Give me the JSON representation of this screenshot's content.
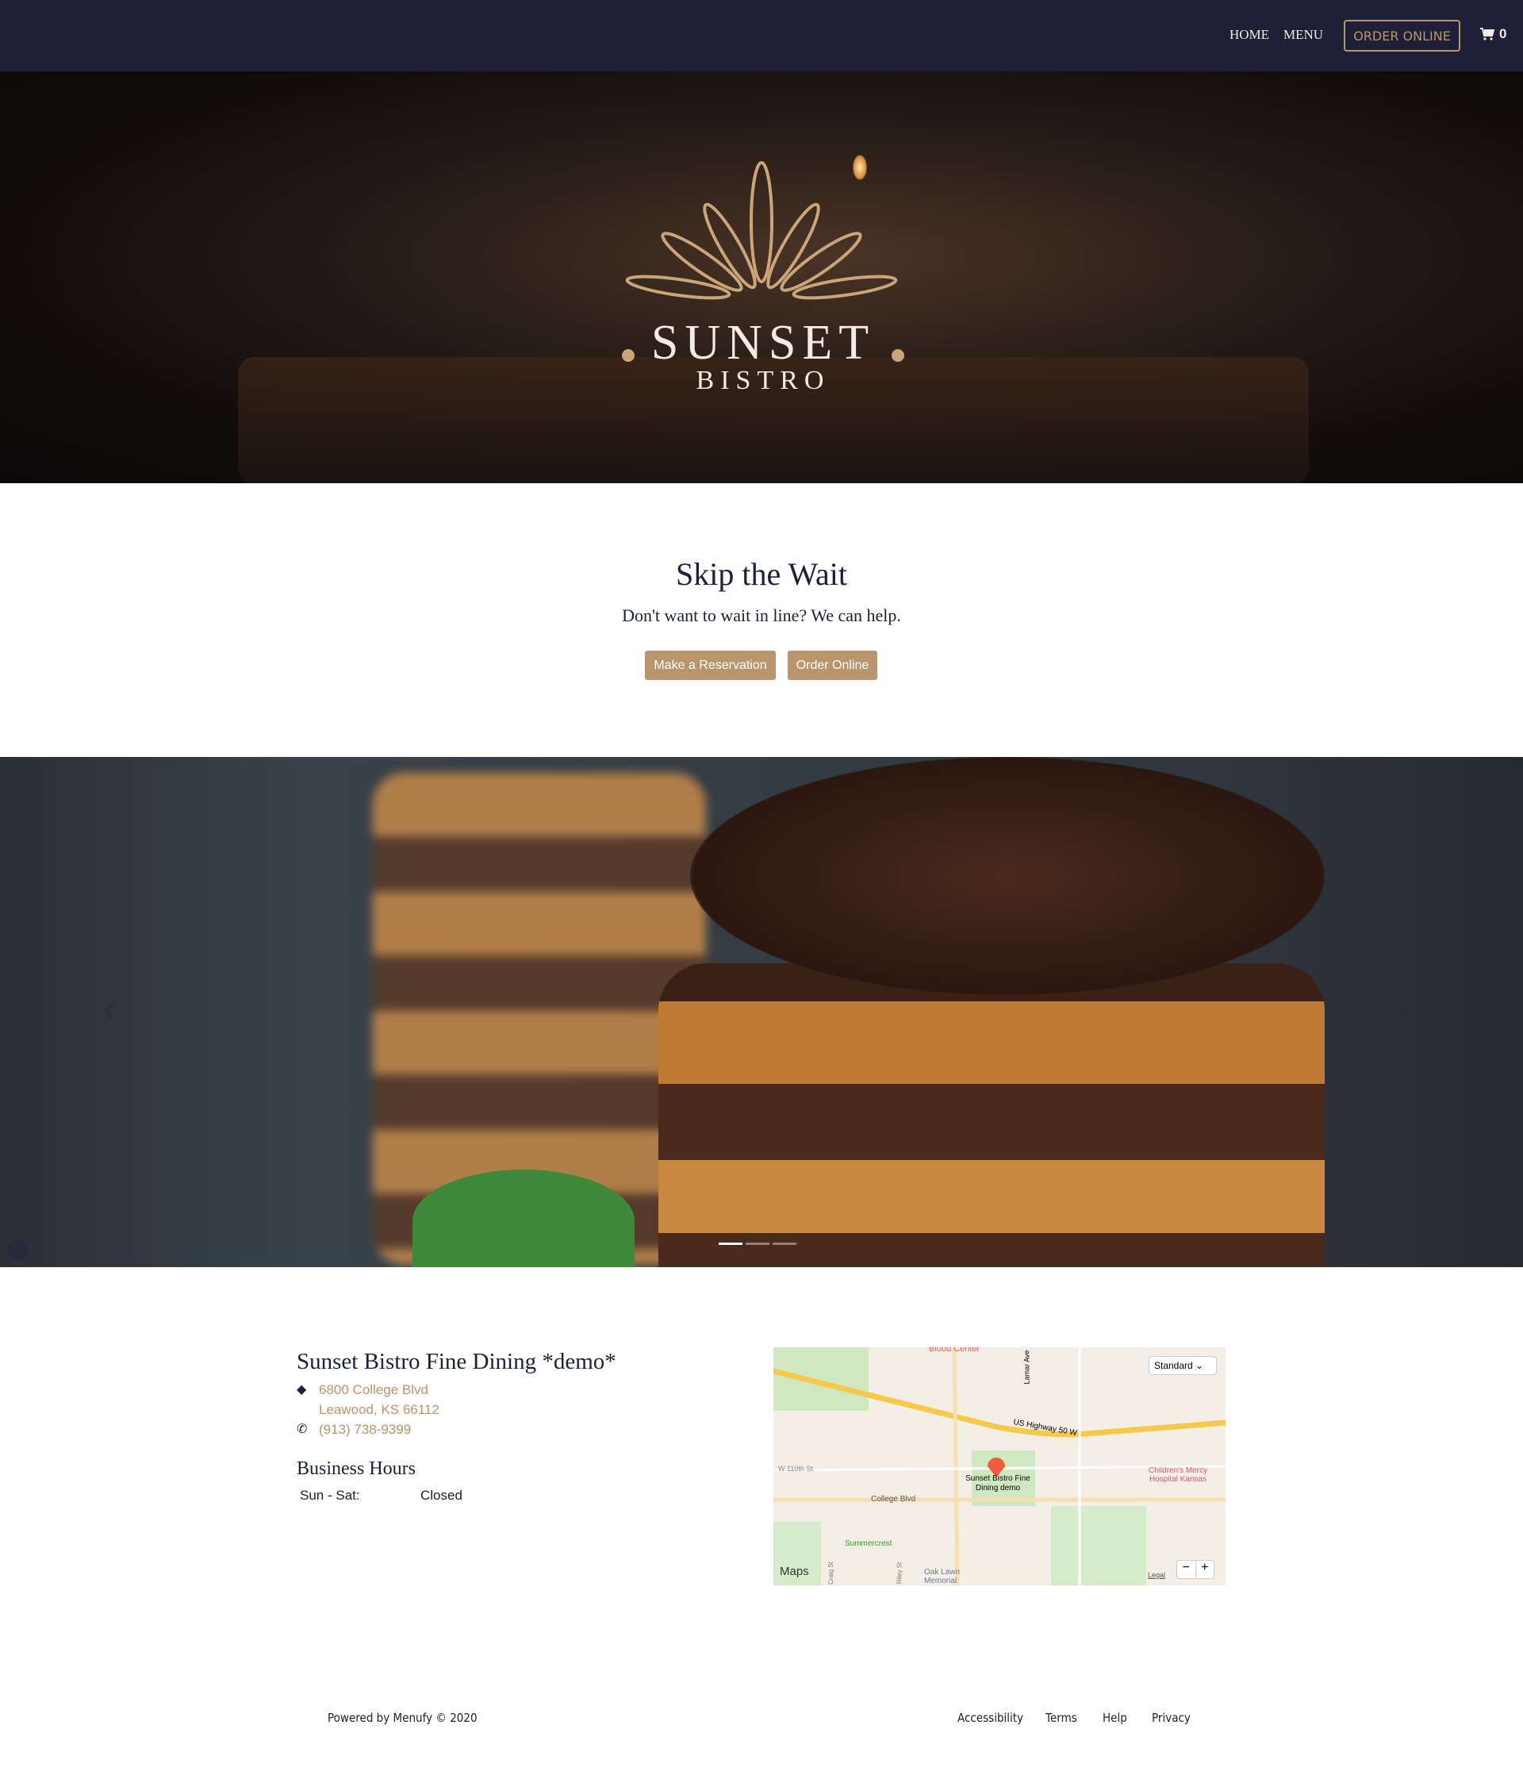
{
  "nav": {
    "home": "HOME",
    "menu": "MENU",
    "order_online": "ORDER ONLINE",
    "cart_count": "0",
    "cart_icon": "shopping-cart-icon"
  },
  "hero": {
    "logo_text": {
      "line1": "SUNSET",
      "line2": "BISTRO"
    }
  },
  "skip": {
    "title": "Skip the Wait",
    "subtitle": "Don't want to wait in line? We can help.",
    "reservation_button": "Make a Reservation",
    "order_button": "Order Online"
  },
  "carousel": {
    "slides": 3,
    "active_slide": 1
  },
  "info": {
    "name": "Sunset Bistro Fine Dining *demo*",
    "address_line1": "6800 College Blvd",
    "address_line2": "Leawood, KS 66112",
    "phone": "(913) 738-9399",
    "hours_title": "Business Hours",
    "hours": [
      {
        "days": "Sun - Sat:",
        "time": "Closed"
      }
    ]
  },
  "map": {
    "type_select": "Standard",
    "pin_label": "Sunset Bistro Fine Dining demo",
    "labels": [
      "Blood Center",
      "Lamar Ave",
      "US Highway 50 W",
      "W 110th St",
      "College Blvd",
      "Children's Mercy Hospital Kansas",
      "Summercrest",
      "Oak Lawn Memorial",
      "Craig St",
      "Riley St"
    ],
    "brand": "Maps",
    "legal": "Legal",
    "zoom_out": "−",
    "zoom_in": "+"
  },
  "footer": {
    "powered": "Powered by Menufy © 2020",
    "links": [
      "Accessibility",
      "Terms",
      "Help",
      "Privacy"
    ]
  },
  "colors": {
    "nav_bg": "#1d2037",
    "accent": "#b8956d"
  }
}
